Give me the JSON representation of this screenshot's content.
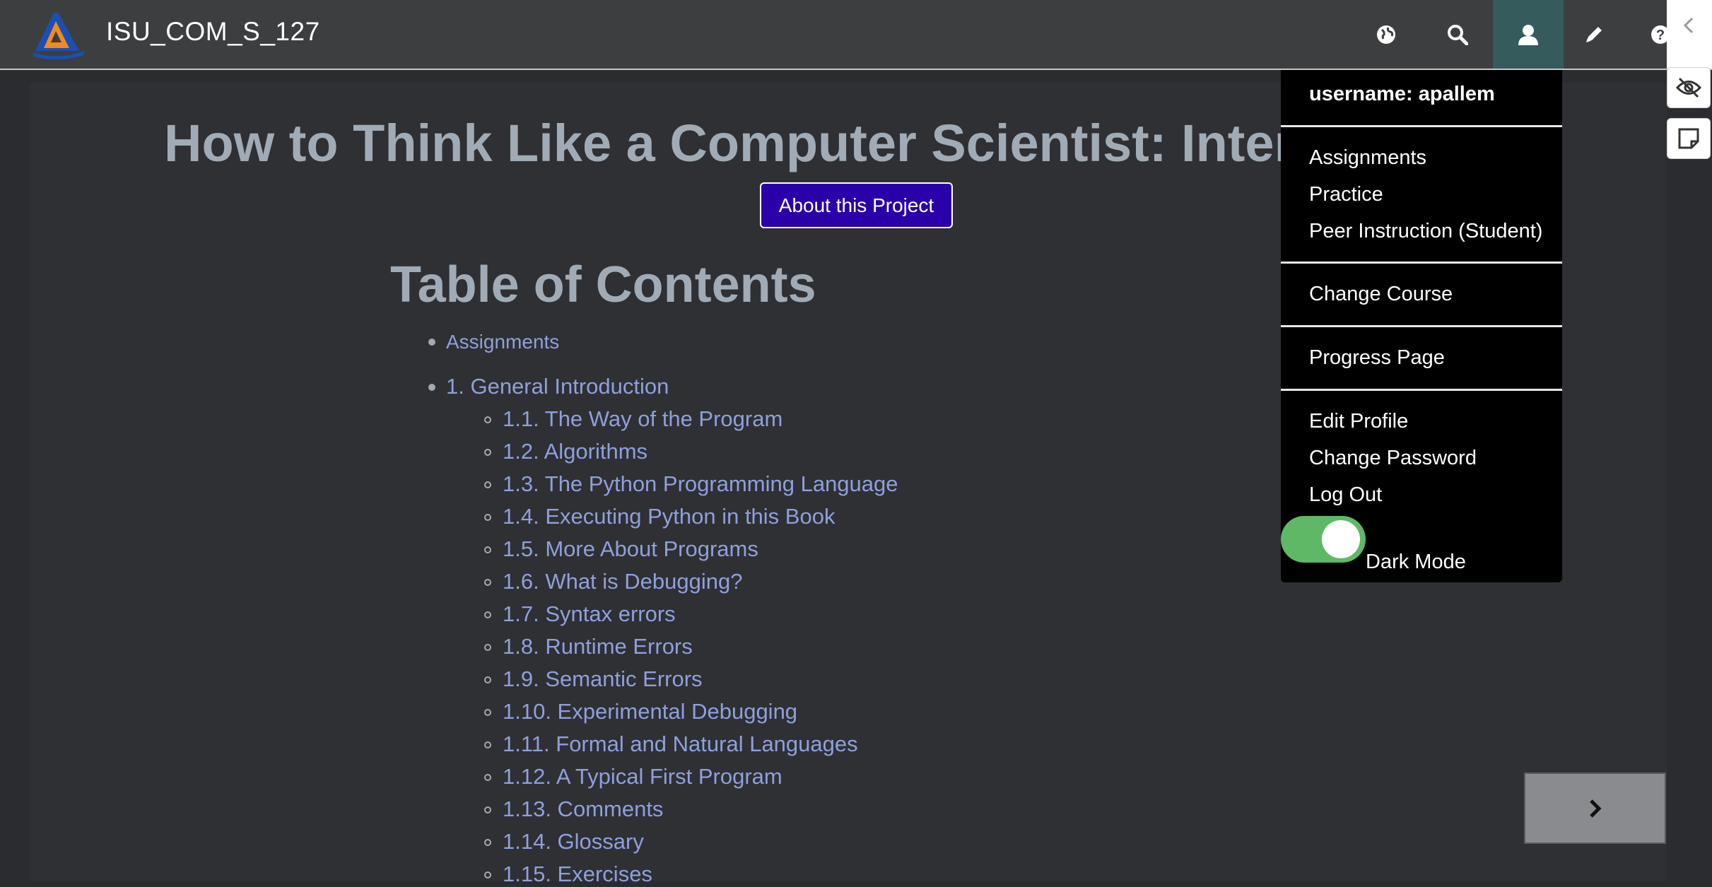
{
  "header": {
    "course_title": "ISU_COM_S_127"
  },
  "main": {
    "book_title": "How to Think Like a Computer Scientist: Interac",
    "about_button": "About this Project",
    "toc_heading": "Table of Contents",
    "toc": [
      {
        "label": "Assignments",
        "level": 1
      },
      {
        "label": "1. General Introduction",
        "level": 1
      },
      {
        "label": "1.1. The Way of the Program",
        "level": 2
      },
      {
        "label": "1.2. Algorithms",
        "level": 2
      },
      {
        "label": "1.3. The Python Programming Language",
        "level": 2
      },
      {
        "label": "1.4. Executing Python in this Book",
        "level": 2
      },
      {
        "label": "1.5. More About Programs",
        "level": 2
      },
      {
        "label": "1.6. What is Debugging?",
        "level": 2
      },
      {
        "label": "1.7. Syntax errors",
        "level": 2
      },
      {
        "label": "1.8. Runtime Errors",
        "level": 2
      },
      {
        "label": "1.9. Semantic Errors",
        "level": 2
      },
      {
        "label": "1.10. Experimental Debugging",
        "level": 2
      },
      {
        "label": "1.11. Formal and Natural Languages",
        "level": 2
      },
      {
        "label": "1.12. A Typical First Program",
        "level": 2
      },
      {
        "label": "1.13. Comments",
        "level": 2
      },
      {
        "label": "1.14. Glossary",
        "level": 2
      },
      {
        "label": "1.15. Exercises",
        "level": 2
      }
    ]
  },
  "user_menu": {
    "username": "username: apallem",
    "items": [
      "Assignments",
      "Practice",
      "Peer Instruction (Student)",
      "Change Course",
      "Progress Page",
      "Edit Profile",
      "Change Password",
      "Log Out"
    ],
    "dark_mode_label": "Dark Mode",
    "dark_mode_on": true
  },
  "icons": {
    "globe": "globe-icon",
    "search": "search-icon",
    "user": "user-icon",
    "edit": "pencil-icon",
    "help": "help-icon",
    "collapse": "chevron-left-icon",
    "hide": "eye-slash-icon",
    "note": "sticky-note-icon",
    "next": "chevron-right-icon"
  },
  "colors": {
    "accent_link": "#8fa0dc",
    "about_button_bg": "#2a00a8",
    "toggle_on": "#5fb865",
    "user_tab": "#355b5d"
  }
}
